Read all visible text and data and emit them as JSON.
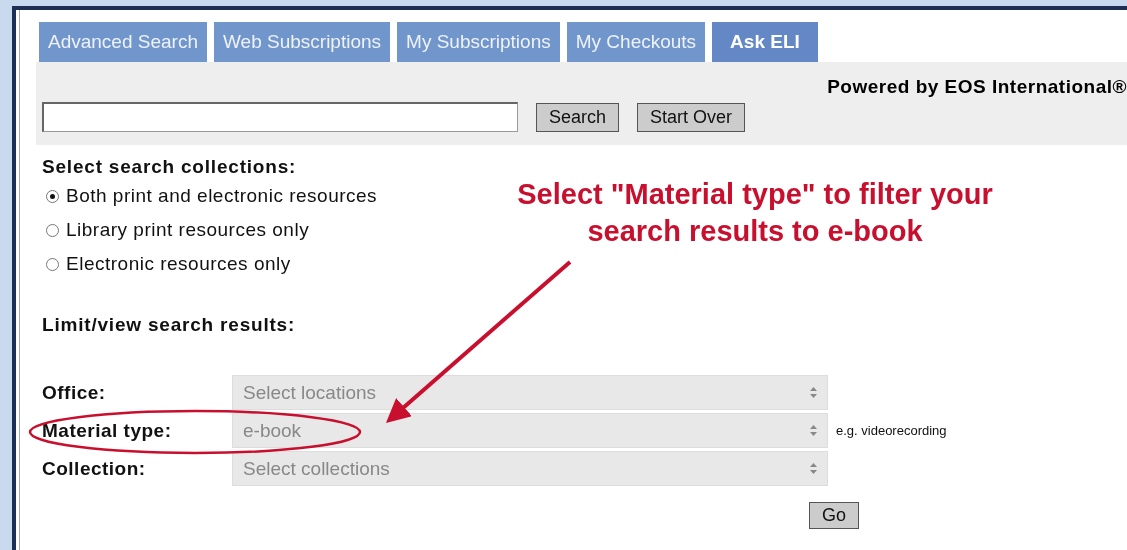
{
  "tabs": [
    {
      "label": "Advanced Search",
      "selected": false
    },
    {
      "label": "Web Subscriptions",
      "selected": false
    },
    {
      "label": "My Subscriptions",
      "selected": false
    },
    {
      "label": "My Checkouts",
      "selected": false
    },
    {
      "label": "Ask ELI",
      "selected": true
    }
  ],
  "powered_by": "Powered by EOS International®",
  "search": {
    "buttons": [
      "Search",
      "Start Over"
    ]
  },
  "collections": {
    "heading": "Select search collections:",
    "options": [
      {
        "label": "Both print and electronic resources",
        "selected": true
      },
      {
        "label": "Library print resources only",
        "selected": false
      },
      {
        "label": "Electronic resources only",
        "selected": false
      }
    ]
  },
  "limits": {
    "heading": "Limit/view search results:",
    "fields": [
      {
        "label": "Office:",
        "value": "Select locations"
      },
      {
        "label": "Material type:",
        "value": "e-book",
        "hint": "e.g. videorecording"
      },
      {
        "label": "Collection:",
        "value": "Select collections"
      }
    ],
    "go": "Go"
  },
  "annotation": {
    "lines": [
      "Select \"Material type\" to filter your",
      "search results to e-book"
    ]
  }
}
